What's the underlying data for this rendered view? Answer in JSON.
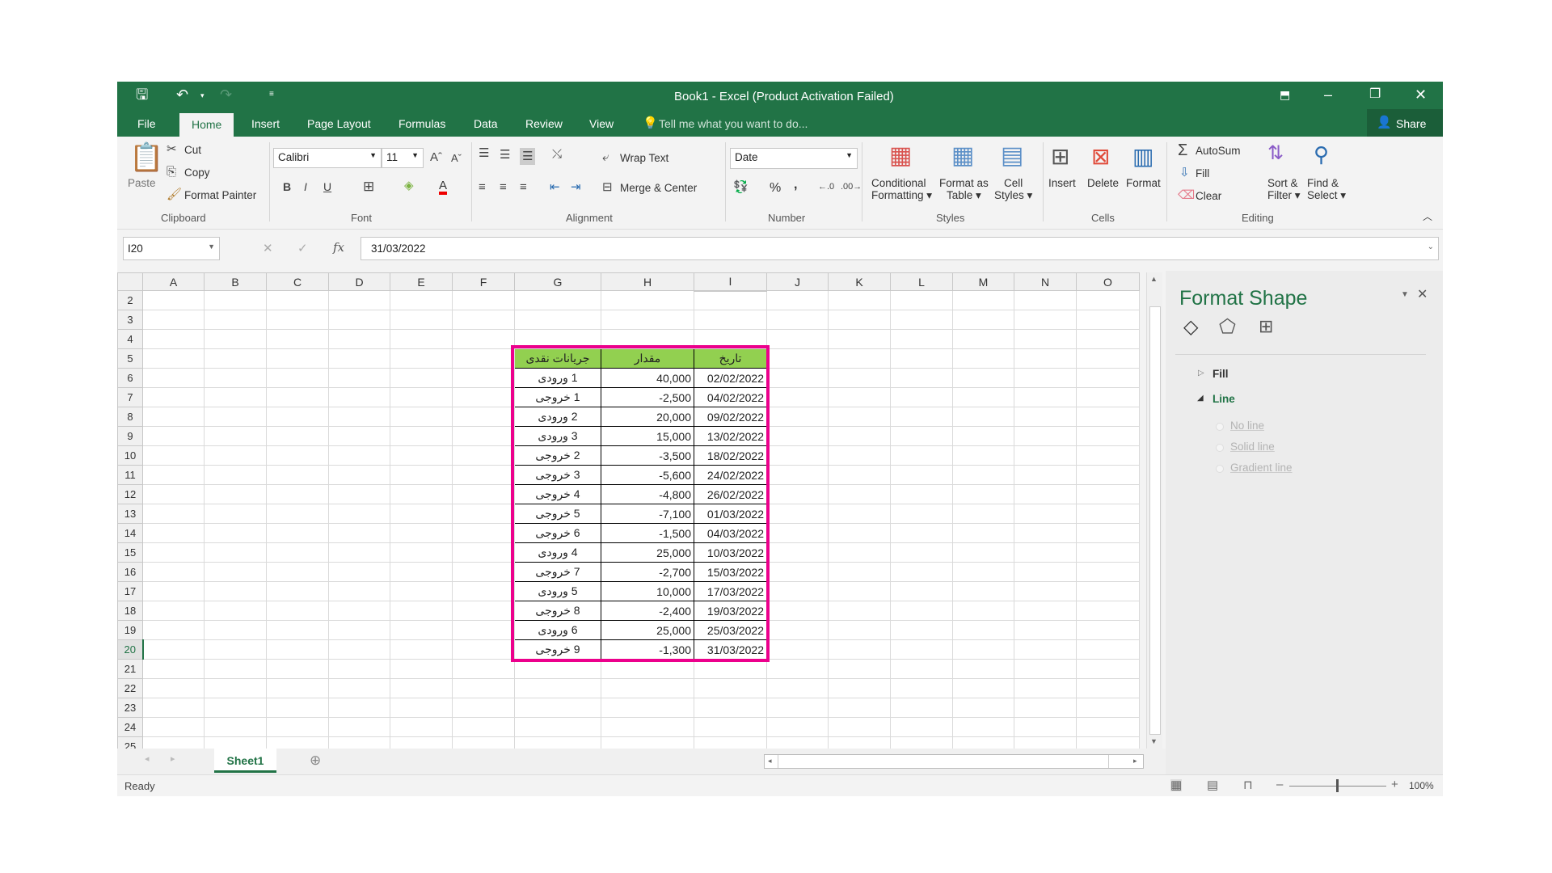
{
  "window": {
    "title": "Book1 - Excel (Product Activation Failed)"
  },
  "qat": {
    "save": "save-icon",
    "undo": "undo-icon",
    "redo": "redo-icon"
  },
  "tabs": [
    {
      "label": "File"
    },
    {
      "label": "Home"
    },
    {
      "label": "Insert"
    },
    {
      "label": "Page Layout"
    },
    {
      "label": "Formulas"
    },
    {
      "label": "Data"
    },
    {
      "label": "Review"
    },
    {
      "label": "View"
    }
  ],
  "tell_me": "Tell me what you want to do...",
  "share": "Share",
  "ribbon": {
    "clipboard": {
      "paste": "Paste",
      "cut": "Cut",
      "copy": "Copy",
      "format_painter": "Format Painter",
      "label": "Clipboard"
    },
    "font": {
      "name": "Calibri",
      "size": "11",
      "bold": "B",
      "italic": "I",
      "underline": "U",
      "label": "Font"
    },
    "alignment": {
      "wrap": "Wrap Text",
      "merge": "Merge & Center",
      "label": "Alignment"
    },
    "number": {
      "format": "Date",
      "percent": "%",
      "comma": ",",
      "label": "Number"
    },
    "styles": {
      "conditional": "Conditional",
      "conditional2": "Formatting",
      "table": "Format as",
      "table2": "Table",
      "cell": "Cell",
      "cell2": "Styles",
      "label": "Styles"
    },
    "cells": {
      "insert": "Insert",
      "delete": "Delete",
      "format": "Format",
      "label": "Cells"
    },
    "editing": {
      "autosum": "AutoSum",
      "fill": "Fill",
      "clear": "Clear",
      "sort": "Sort &",
      "sort2": "Filter",
      "find": "Find &",
      "find2": "Select",
      "label": "Editing"
    }
  },
  "formula_bar": {
    "name_box": "I20",
    "fx": "fx",
    "value": "31/03/2022"
  },
  "columns": [
    "A",
    "B",
    "C",
    "D",
    "E",
    "F",
    "G",
    "H",
    "I",
    "J",
    "K",
    "L",
    "M",
    "N",
    "O"
  ],
  "selected_column": "I",
  "selected_row": 20,
  "first_row": 2,
  "last_row": 25,
  "colors": {
    "accent": "#217346",
    "table_header": "#92d050",
    "highlight_border": "#ec008c"
  },
  "table": {
    "headers": [
      "جریانات نقدی",
      "مقدار",
      "تاریخ"
    ],
    "rows": [
      [
        "1 ورودی",
        "40,000",
        "02/02/2022"
      ],
      [
        "1 خروجی",
        "-2,500",
        "04/02/2022"
      ],
      [
        "2 ورودی",
        "20,000",
        "09/02/2022"
      ],
      [
        "3 ورودی",
        "15,000",
        "13/02/2022"
      ],
      [
        "2 خروجی",
        "-3,500",
        "18/02/2022"
      ],
      [
        "3 خروجی",
        "-5,600",
        "24/02/2022"
      ],
      [
        "4 خروجی",
        "-4,800",
        "26/02/2022"
      ],
      [
        "5 خروجی",
        "-7,100",
        "01/03/2022"
      ],
      [
        "6 خروجی",
        "-1,500",
        "04/03/2022"
      ],
      [
        "4 ورودی",
        "25,000",
        "10/03/2022"
      ],
      [
        "7 خروجی",
        "-2,700",
        "15/03/2022"
      ],
      [
        "5 ورودی",
        "10,000",
        "17/03/2022"
      ],
      [
        "8 خروجی",
        "-2,400",
        "19/03/2022"
      ],
      [
        "6 ورودی",
        "25,000",
        "25/03/2022"
      ],
      [
        "9 خروجی",
        "-1,300",
        "31/03/2022"
      ]
    ]
  },
  "sheets": [
    {
      "label": "Sheet1",
      "active": true
    }
  ],
  "status": {
    "text": "Ready",
    "zoom": "100%"
  },
  "pane": {
    "title": "Format Shape",
    "fill": "Fill",
    "line": "Line",
    "options": [
      "No line",
      "Solid line",
      "Gradient line"
    ]
  }
}
